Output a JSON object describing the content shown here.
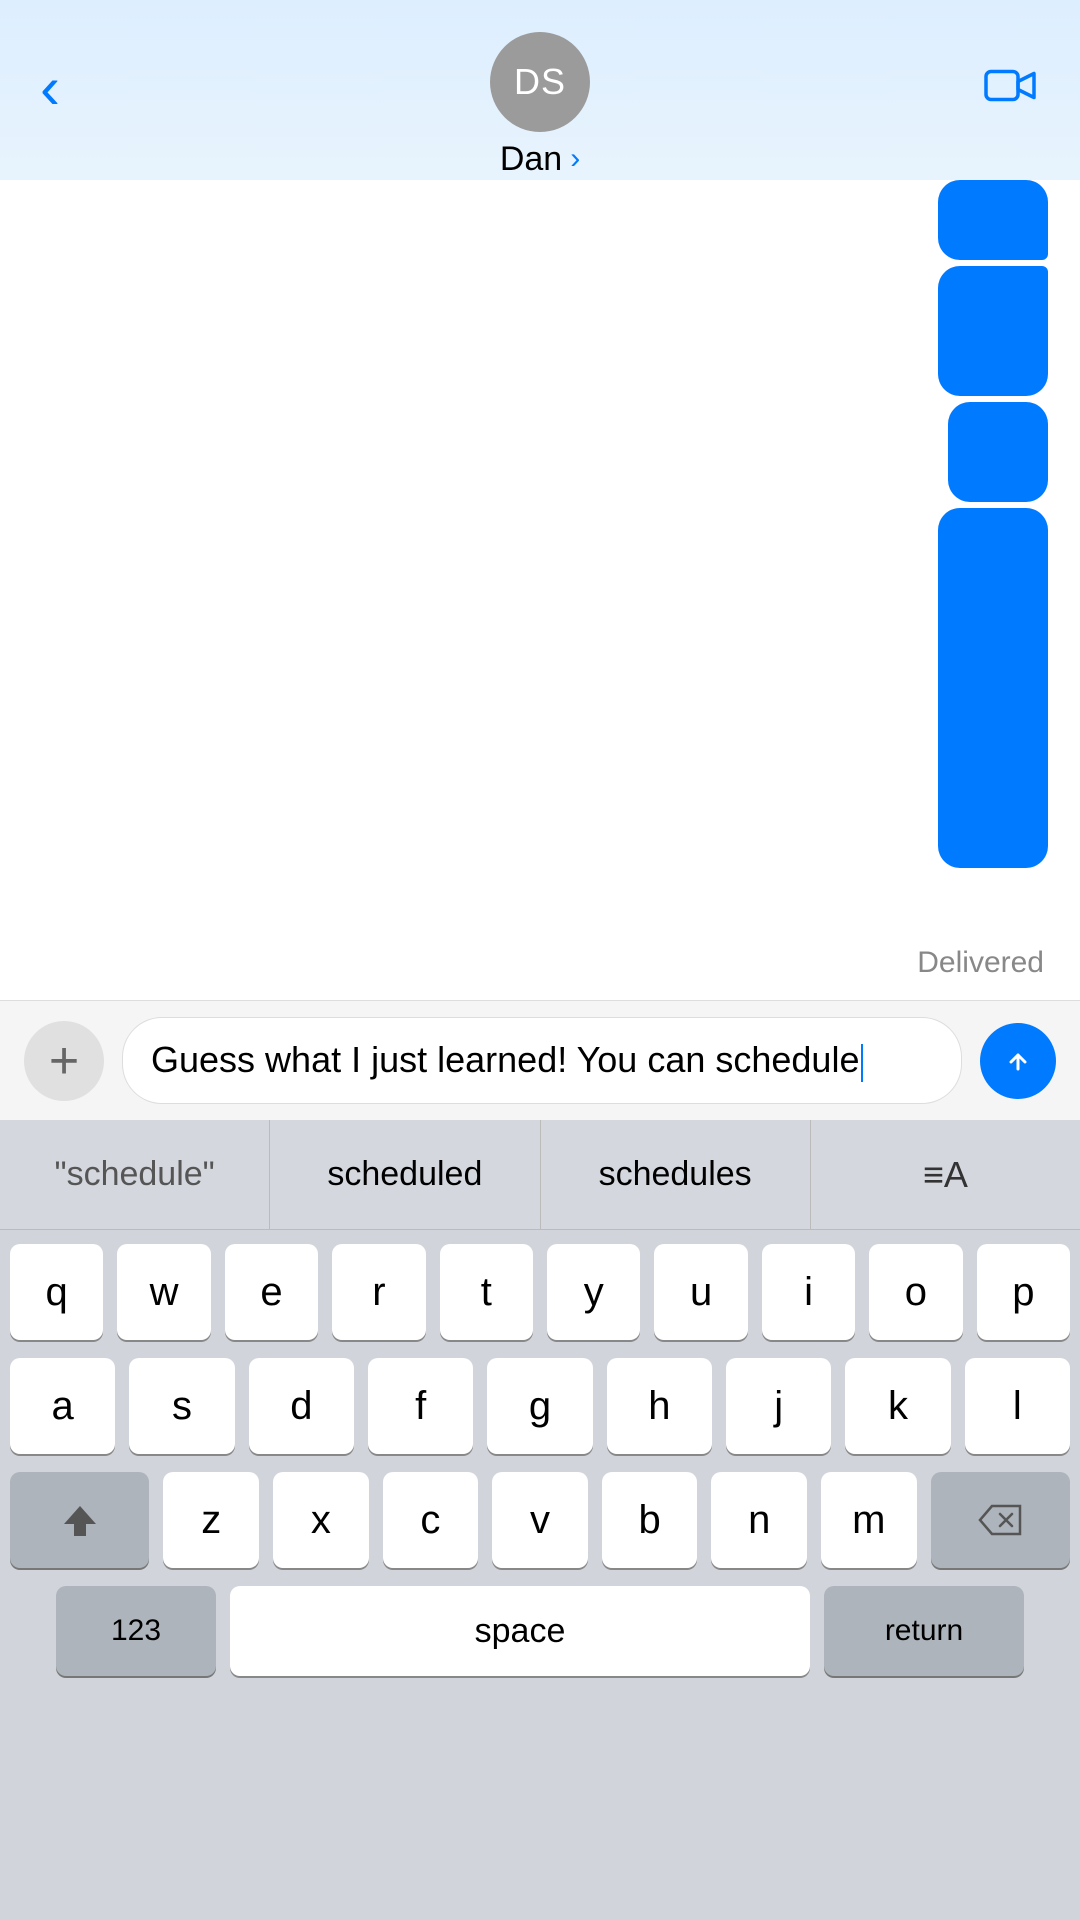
{
  "header": {
    "back_label": "‹",
    "avatar_initials": "DS",
    "contact_name": "Dan",
    "contact_chevron": "›",
    "video_icon": "📹"
  },
  "messages": {
    "delivered_label": "Delivered"
  },
  "input_bar": {
    "add_icon": "+",
    "message_text": "Guess what I just learned! You can schedule",
    "send_icon_label": "send"
  },
  "autocomplete": {
    "items": [
      {
        "label": "\"schedule\"",
        "type": "quoted"
      },
      {
        "label": "scheduled",
        "type": "normal"
      },
      {
        "label": "schedules",
        "type": "normal"
      },
      {
        "label": "≡A",
        "type": "special"
      }
    ]
  },
  "keyboard": {
    "rows": [
      [
        "q",
        "w",
        "e",
        "r",
        "t",
        "y",
        "u",
        "i",
        "o",
        "p"
      ],
      [
        "a",
        "s",
        "d",
        "f",
        "g",
        "h",
        "j",
        "k",
        "l"
      ],
      [
        "z",
        "x",
        "c",
        "v",
        "b",
        "n",
        "m"
      ]
    ],
    "shift_label": "⇧",
    "delete_label": "⌫",
    "numbers_label": "123",
    "space_label": "space",
    "return_label": "return"
  }
}
